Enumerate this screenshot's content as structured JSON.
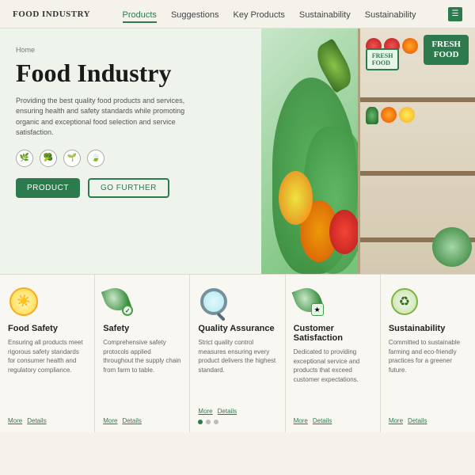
{
  "nav": {
    "logo": "FOOD INDUSTRY",
    "links": [
      {
        "label": "Products",
        "active": true
      },
      {
        "label": "Suggestions"
      },
      {
        "label": "Key Products"
      },
      {
        "label": "Sustainability"
      },
      {
        "label": "Sustainability"
      }
    ]
  },
  "hero": {
    "breadcrumb": "Home",
    "title": "Food Industry",
    "description": "Providing the best quality food products and services, ensuring\nhealth and safety standards while promoting organic and\nexceptional food selection and service satisfaction.",
    "icons": [
      "🌿",
      "🥦",
      "🌱",
      "🍃"
    ],
    "btn_primary": "PRODUCT",
    "btn_secondary": "GO FURTHER",
    "fresh_food_tag": "FRESH\nFOOD"
  },
  "features": [
    {
      "id": "food-safety",
      "icon_type": "sun",
      "title": "Food Safety",
      "description": "Ensuring all products meet rigorous safety standards for consumer health and regulatory compliance.",
      "links": [
        "More",
        "Details"
      ]
    },
    {
      "id": "safety",
      "icon_type": "leaf-small",
      "title": "Safety",
      "description": "Comprehensive safety protocols applied throughout the supply chain from farm to table.",
      "links": [
        "More",
        "Details"
      ]
    },
    {
      "id": "quality-assurance",
      "icon_type": "magnifier",
      "title": "Quality Assurance",
      "description": "Strict quality control measures ensuring every product delivers the highest standard.",
      "links": [
        "More",
        "Details"
      ]
    },
    {
      "id": "customer-satisfaction",
      "icon_type": "leaf-badge",
      "title": "Customer Satisfaction",
      "description": "Dedicated to providing exceptional service and products that exceed customer expectations.",
      "links": [
        "More",
        "Details"
      ]
    },
    {
      "id": "sustainability",
      "icon_type": "recycle",
      "title": "Sustainability",
      "description": "Committed to sustainable farming and eco-friendly practices for a greener future.",
      "links": [
        "More",
        "Details"
      ]
    }
  ]
}
